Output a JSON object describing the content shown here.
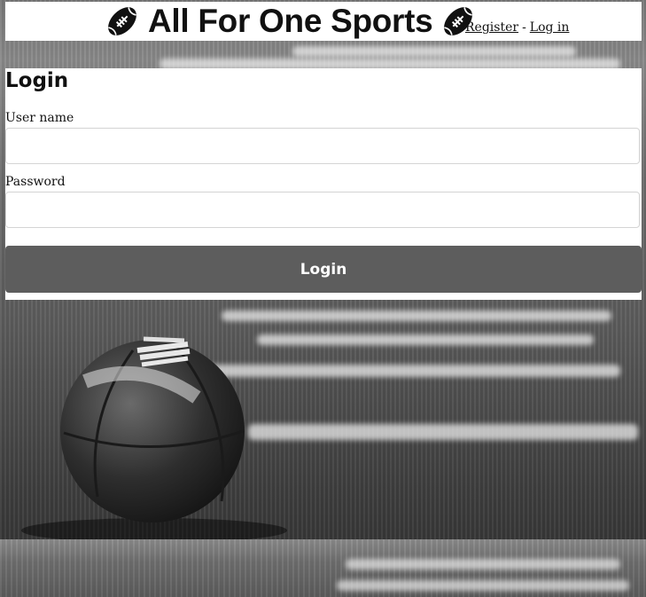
{
  "header": {
    "brand_title": "All For One Sports",
    "register_link": "Register",
    "separator": "-",
    "login_link": "Log in"
  },
  "login": {
    "heading": "Login",
    "username_label": "User name",
    "username_value": "",
    "password_label": "Password",
    "password_value": "",
    "submit_label": "Login"
  },
  "icons": {
    "brand_left": "football-icon",
    "brand_right": "football-icon"
  },
  "colors": {
    "button_bg": "#5d5d5d",
    "button_text": "#ffffff",
    "panel_bg": "#ffffff"
  }
}
